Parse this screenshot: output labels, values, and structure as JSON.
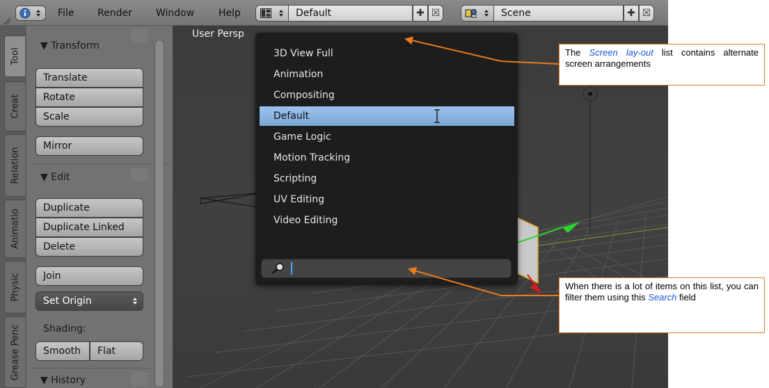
{
  "menubar": {
    "items": [
      "File",
      "Render",
      "Window",
      "Help"
    ],
    "screen_layout": {
      "value": "Default"
    },
    "scene": {
      "value": "Scene"
    }
  },
  "tabs": [
    "Tool",
    "Creat",
    "Relation",
    "Animatio",
    "Physic",
    "Grease Penc"
  ],
  "toolshelf": {
    "transform_title": "Transform",
    "transform_buttons": [
      "Translate",
      "Rotate",
      "Scale"
    ],
    "mirror": "Mirror",
    "edit_title": "Edit",
    "edit_buttons": [
      "Duplicate",
      "Duplicate Linked",
      "Delete"
    ],
    "join": "Join",
    "set_origin": "Set Origin",
    "shading_label": "Shading:",
    "shading_smooth": "Smooth",
    "shading_flat": "Flat",
    "history_title": "History"
  },
  "viewport": {
    "label": "User Persp"
  },
  "dropdown": {
    "items": [
      "3D View Full",
      "Animation",
      "Compositing",
      "Default",
      "Game Logic",
      "Motion Tracking",
      "Scripting",
      "UV Editing",
      "Video Editing"
    ],
    "selected_index": 3,
    "search_value": ""
  },
  "callouts": {
    "top": {
      "pre": "The ",
      "em": "Screen lay-out",
      "post": " list contains alternate screen arrangements"
    },
    "bottom": {
      "pre": "When there is a lot of items on this list, you can filter them using this ",
      "em": "Search",
      "post": " field"
    }
  },
  "colors": {
    "accent_orange": "#e87b1e",
    "selection_blue": "#7ba6d6",
    "link_blue": "#1a55d6"
  }
}
